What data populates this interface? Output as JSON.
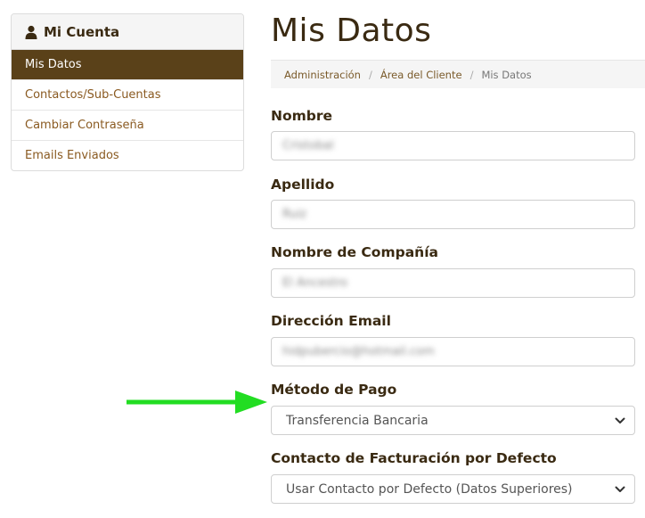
{
  "sidebar": {
    "title": "Mi Cuenta",
    "items": [
      {
        "label": "Mis Datos",
        "active": true
      },
      {
        "label": "Contactos/Sub-Cuentas",
        "active": false
      },
      {
        "label": "Cambiar Contraseña",
        "active": false
      },
      {
        "label": "Emails Enviados",
        "active": false
      }
    ]
  },
  "main": {
    "title": "Mis Datos",
    "breadcrumb": {
      "items": [
        "Administración",
        "Área del Cliente"
      ],
      "current": "Mis Datos"
    },
    "fields": {
      "nombre": {
        "label": "Nombre",
        "value": "Cristobal"
      },
      "apellido": {
        "label": "Apellido",
        "value": "Ruiz"
      },
      "compania": {
        "label": "Nombre de Compañía",
        "value": "El Ancestro"
      },
      "email": {
        "label": "Dirección Email",
        "value": "hidpubercio@hotmail.com"
      },
      "metodo_pago": {
        "label": "Método de Pago",
        "value": "Transferencia Bancaria"
      },
      "contacto_facturacion": {
        "label": "Contacto de Facturación por Defecto",
        "value": "Usar Contacto por Defecto (Datos Superiores)"
      }
    }
  },
  "colors": {
    "accent": "#5a4119",
    "link": "#8a5a21",
    "arrow": "#22dd22"
  }
}
